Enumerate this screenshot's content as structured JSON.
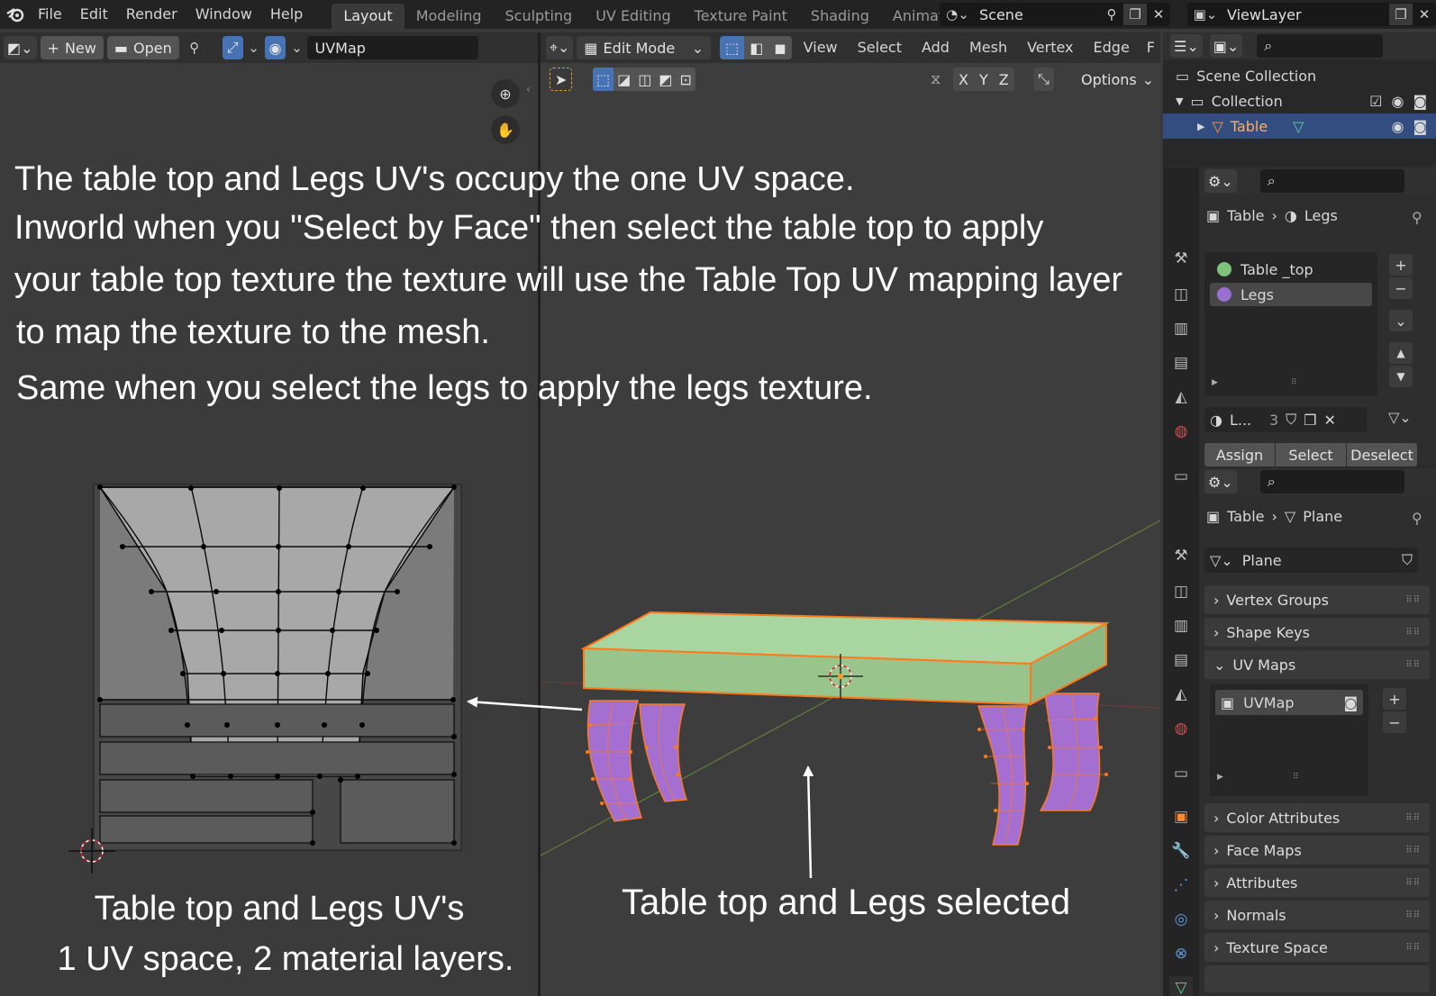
{
  "topbar": {
    "menus": [
      "File",
      "Edit",
      "Render",
      "Window",
      "Help"
    ],
    "workspaces": [
      "Layout",
      "Modeling",
      "Sculpting",
      "UV Editing",
      "Texture Paint",
      "Shading",
      "Animati"
    ],
    "active_workspace": "Layout",
    "scene": "Scene",
    "view_layer": "ViewLayer"
  },
  "uv_editor": {
    "new_label": "New",
    "open_label": "Open",
    "image_field": "UVMap"
  },
  "viewport": {
    "mode": "Edit Mode",
    "menus": [
      "View",
      "Select",
      "Add",
      "Mesh",
      "Vertex",
      "Edge",
      "F"
    ],
    "axes": [
      "X",
      "Y",
      "Z"
    ],
    "options_label": "Options"
  },
  "outliner": {
    "scene_collection": "Scene Collection",
    "collection": "Collection",
    "object": "Table"
  },
  "material_panel": {
    "breadcrumb_object": "Table",
    "breadcrumb_material": "Legs",
    "slots": [
      "Table _top",
      "Legs"
    ],
    "slot_colors": [
      "#7fc07a",
      "#9a6fd0"
    ],
    "active_slot": "Legs",
    "material_name": "L...",
    "user_count": "3",
    "assign_label": "Assign",
    "select_label": "Select",
    "deselect_label": "Deselect"
  },
  "data_panel": {
    "breadcrumb_object": "Table",
    "breadcrumb_mesh": "Plane",
    "mesh_name": "Plane",
    "sections": [
      "Vertex Groups",
      "Shape Keys",
      "UV Maps",
      "Color Attributes",
      "Face Maps",
      "Attributes",
      "Normals",
      "Texture Space"
    ],
    "uv_map_item": "UVMap"
  },
  "annotations": {
    "line1": "The table top and Legs UV's occupy the one UV space.",
    "line2": "Inworld when you \"Select by Face\" then select the table top to apply",
    "line3": "your table top texture the texture will use the Table Top UV mapping layer",
    "line4": "to map the texture to the mesh.",
    "line5": "Same when you select the legs to apply the legs texture.",
    "uv_caption_1": "Table top and Legs UV's",
    "uv_caption_2": "1 UV space, 2 material layers.",
    "viewport_caption": "Table top and Legs selected"
  },
  "colors": {
    "accent_blue": "#4772b3",
    "top_face": "#a6d19a",
    "legs_face": "#a66fd3",
    "edge_select": "#ff7a1a"
  }
}
